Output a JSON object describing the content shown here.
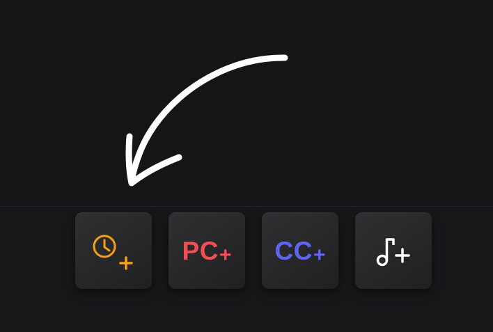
{
  "toolbar": {
    "buttons": [
      {
        "icon": "clock-plus-icon",
        "color": "#f7a116"
      },
      {
        "label": "PC",
        "plus": "+",
        "color": "#ef4f54"
      },
      {
        "label": "CC",
        "plus": "+",
        "color": "#5e64ef"
      },
      {
        "icon": "music-note-plus-icon",
        "color": "#ffffff"
      }
    ]
  },
  "colors": {
    "background": "#151517",
    "bar_background": "#17171a",
    "button_background": "#2a2a2d",
    "arrow": "#ffffff"
  }
}
